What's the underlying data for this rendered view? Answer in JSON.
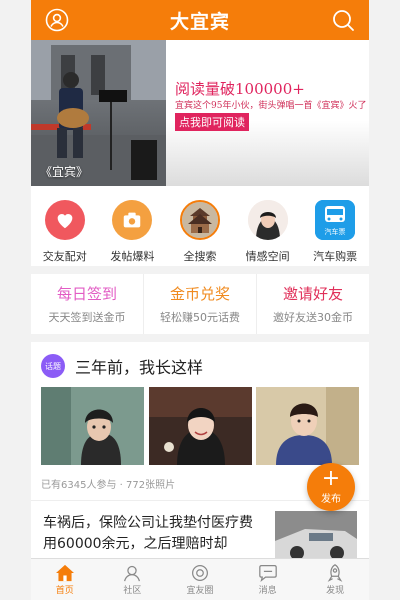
{
  "header": {
    "title": "大宜宾",
    "left_icon": "user-icon",
    "right_icon": "search-icon",
    "color": "#f57d0a"
  },
  "banner": {
    "headline": "阅读量破100000+",
    "subline": "宜宾这个95年小伙，街头弹唱一首《宜宾》火了",
    "cta": "点我即可阅读",
    "caption": "《宜宾》"
  },
  "quick": [
    {
      "label": "交友配对",
      "icon": "heart-icon"
    },
    {
      "label": "发帖爆料",
      "icon": "camera-icon"
    },
    {
      "label": "全搜索",
      "icon": "tower-icon"
    },
    {
      "label": "情感空间",
      "icon": "avatar-icon"
    },
    {
      "label": "汽车购票",
      "icon": "bus-ticket-icon",
      "badge": "汽车票"
    }
  ],
  "promo": [
    {
      "title": "每日签到",
      "sub": "天天签到送金币",
      "color": "#e25cc4"
    },
    {
      "title": "金币兑奖",
      "sub": "轻松赚50元话费",
      "color": "#f08a1e"
    },
    {
      "title": "邀请好友",
      "sub": "邀好友送30金币",
      "color": "#e0305a"
    }
  ],
  "topic": {
    "tag": "话题",
    "title": "三年前，我长这样",
    "meta": "已有6345人参与 · 772张照片"
  },
  "news": {
    "text": "车祸后，保险公司让我垫付医疗费用60000余元，之后理赔时却"
  },
  "fab": {
    "label": "发布"
  },
  "tabs": [
    {
      "label": "首页",
      "icon": "home-icon",
      "active": true
    },
    {
      "label": "社区",
      "icon": "community-icon",
      "active": false
    },
    {
      "label": "宜友圈",
      "icon": "camera-circle-icon",
      "active": false
    },
    {
      "label": "消息",
      "icon": "message-icon",
      "active": false
    },
    {
      "label": "发现",
      "icon": "rocket-icon",
      "active": false
    }
  ]
}
